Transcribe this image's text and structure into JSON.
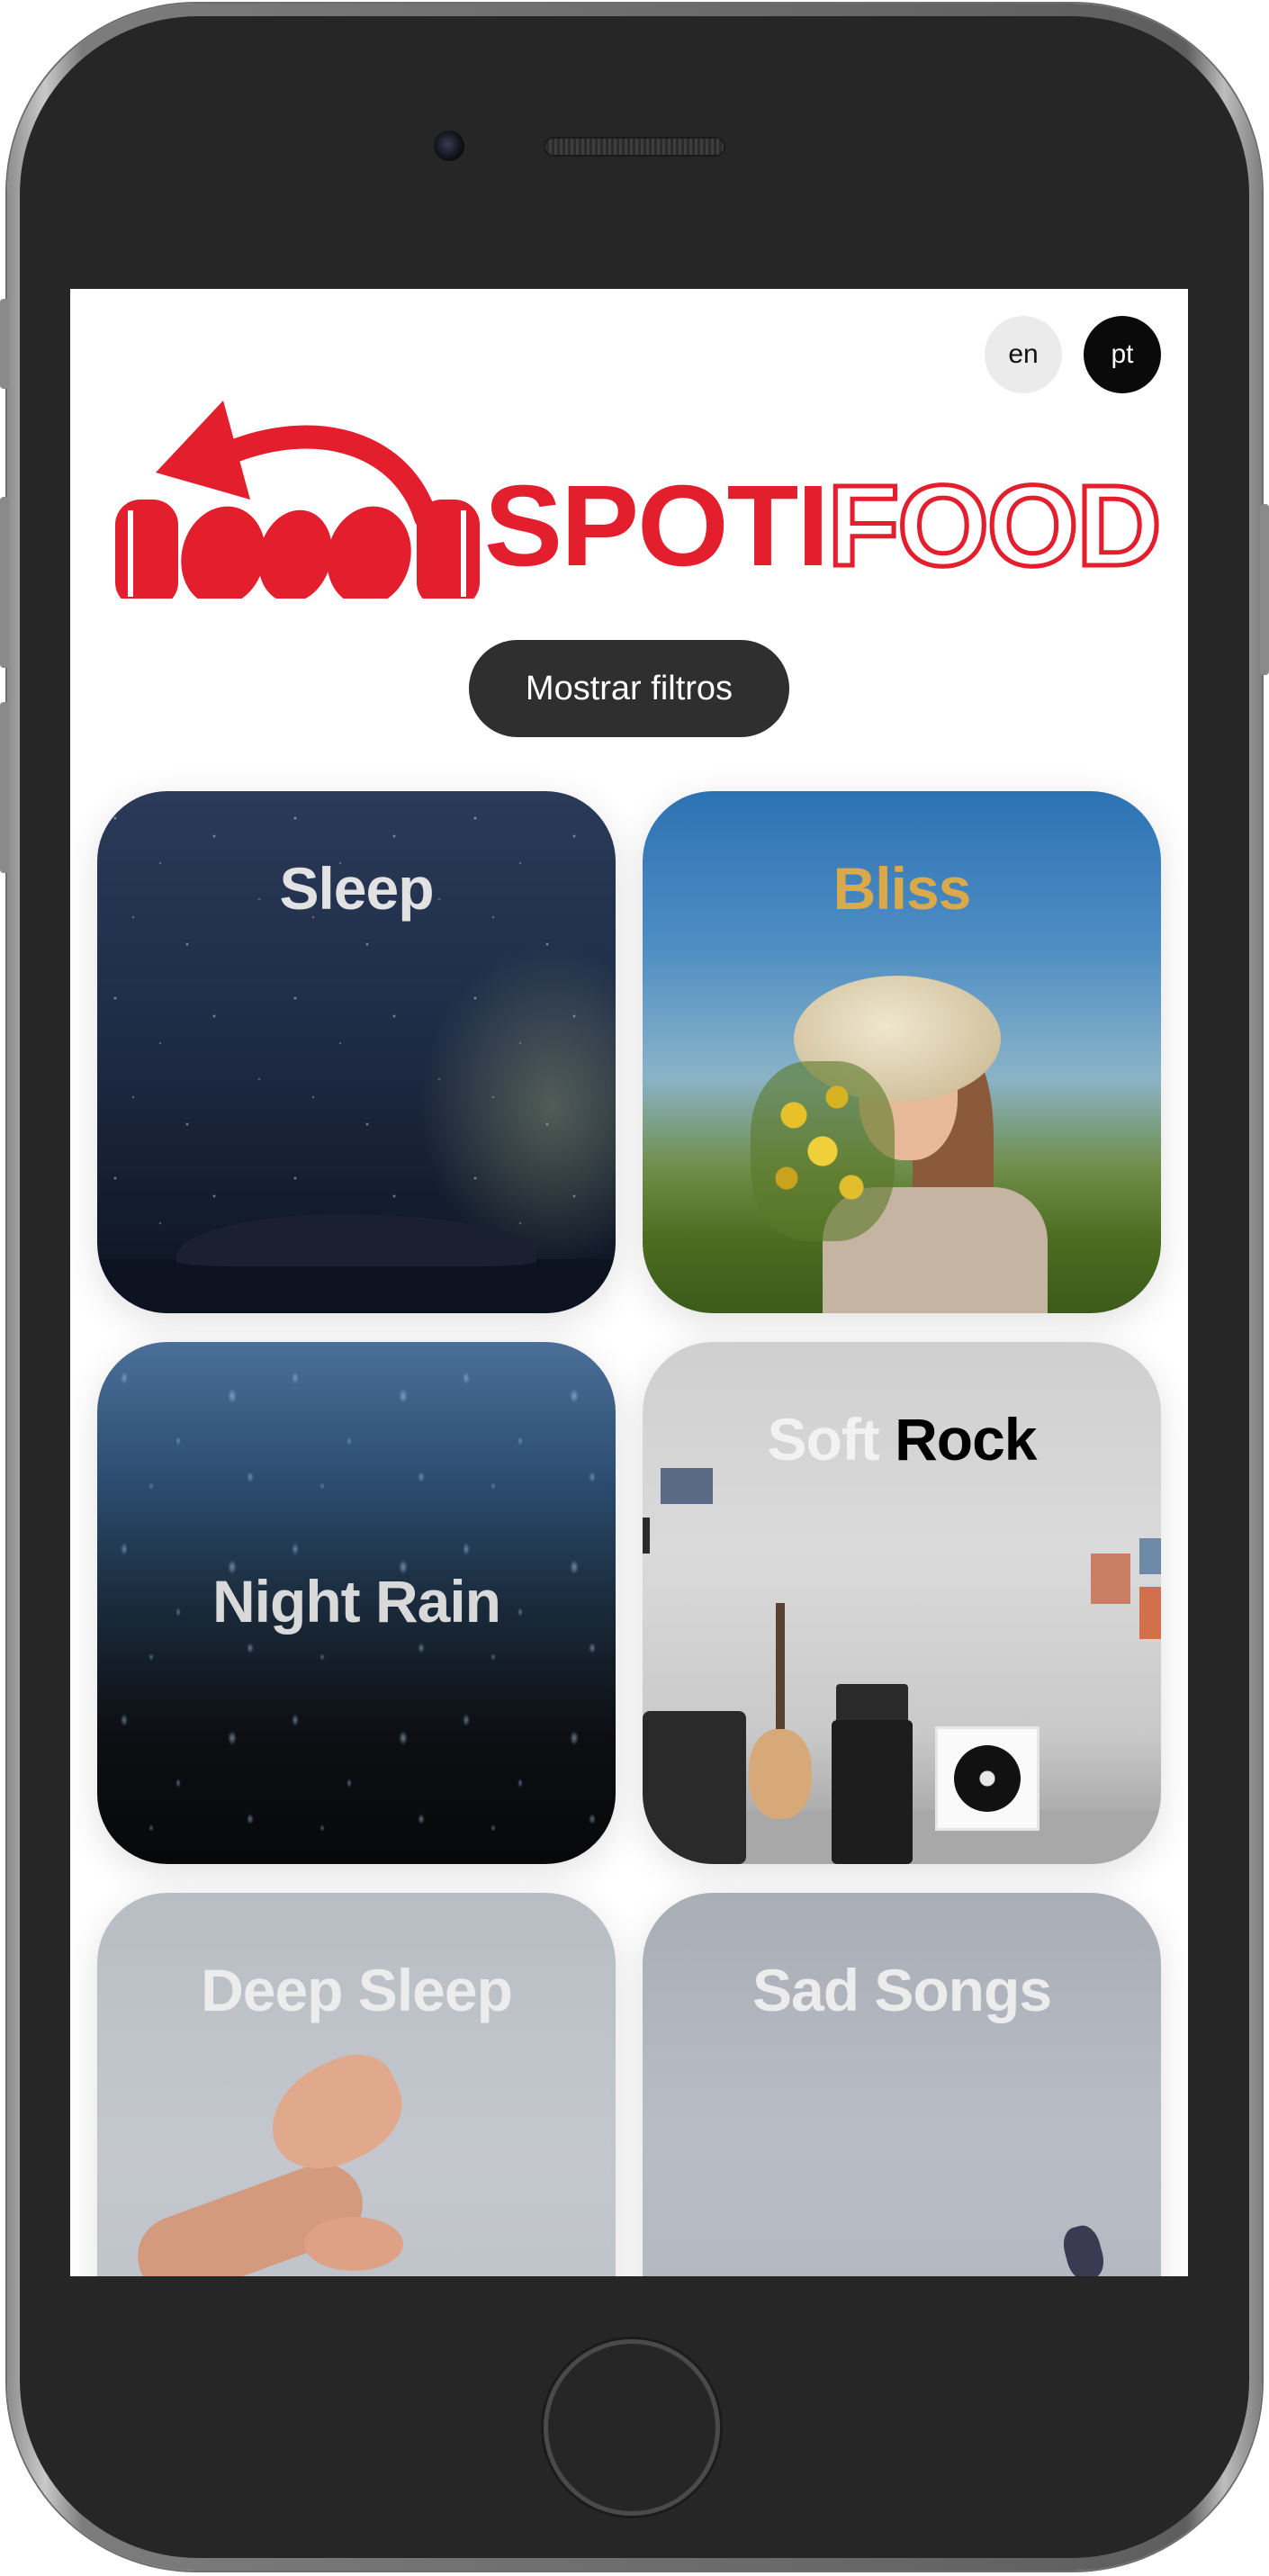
{
  "languages": {
    "en": "en",
    "pt": "pt"
  },
  "brand": {
    "name_part1": "SPOTI",
    "name_part2": "FOOD",
    "color": "#e31e2d"
  },
  "filters_button": {
    "label": "Mostrar filtros"
  },
  "playlists": [
    {
      "title": "Sleep",
      "title_color": "#e6e6e6"
    },
    {
      "title": "Bliss",
      "title_color": "#d9a94a"
    },
    {
      "title": "Night Rain",
      "title_color": "#dcdcdc"
    },
    {
      "title_part1": "Soft",
      "title_part2": "Rock",
      "title_color_part1": "#f2f2f2",
      "title_color_part2": "#000000"
    },
    {
      "title": "Deep Sleep",
      "title_color": "#ececec"
    },
    {
      "title": "Sad Songs",
      "title_color": "#ececec"
    }
  ],
  "icons": {
    "logo": "headphones-arrow-logo"
  }
}
